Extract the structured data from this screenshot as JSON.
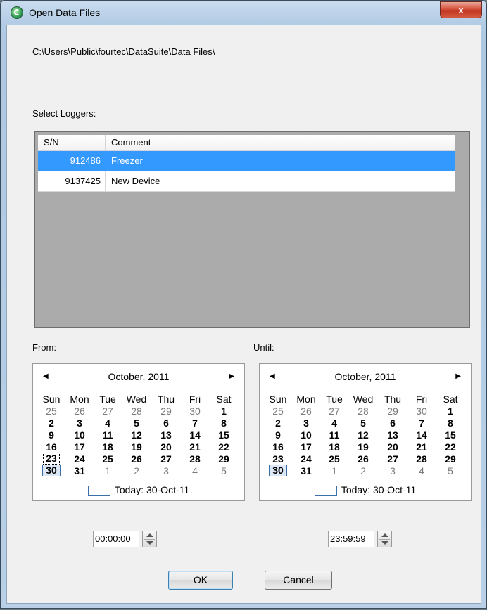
{
  "window": {
    "title": "Open Data Files",
    "close_label": "x"
  },
  "path": "C:\\Users\\Public\\fourtec\\DataSuite\\Data Files\\",
  "loggers": {
    "label": "Select Loggers:",
    "columns": [
      "S/N",
      "Comment"
    ],
    "rows": [
      {
        "sn": "912486",
        "comment": "Freezer",
        "selected": true
      },
      {
        "sn": "9137425",
        "comment": "New Device",
        "selected": false
      }
    ]
  },
  "from": {
    "label": "From:",
    "month": "October, 2011",
    "today_text": "Today: 30-Oct-11",
    "time": "00:00:00",
    "focused_day": "23",
    "selected_day": "30"
  },
  "until": {
    "label": "Until:",
    "month": "October, 2011",
    "today_text": "Today: 30-Oct-11",
    "time": "23:59:59",
    "selected_day": "30"
  },
  "calendar": {
    "weekdays": [
      "Sun",
      "Mon",
      "Tue",
      "Wed",
      "Thu",
      "Fri",
      "Sat"
    ],
    "weeks": [
      [
        "25",
        "26",
        "27",
        "28",
        "29",
        "30",
        "1"
      ],
      [
        "2",
        "3",
        "4",
        "5",
        "6",
        "7",
        "8"
      ],
      [
        "9",
        "10",
        "11",
        "12",
        "13",
        "14",
        "15"
      ],
      [
        "16",
        "17",
        "18",
        "19",
        "20",
        "21",
        "22"
      ],
      [
        "23",
        "24",
        "25",
        "26",
        "27",
        "28",
        "29"
      ],
      [
        "30",
        "31",
        "1",
        "2",
        "3",
        "4",
        "5"
      ]
    ],
    "prev_icon": "left-arrow-icon",
    "next_icon": "right-arrow-icon"
  },
  "buttons": {
    "ok": "OK",
    "cancel": "Cancel"
  }
}
